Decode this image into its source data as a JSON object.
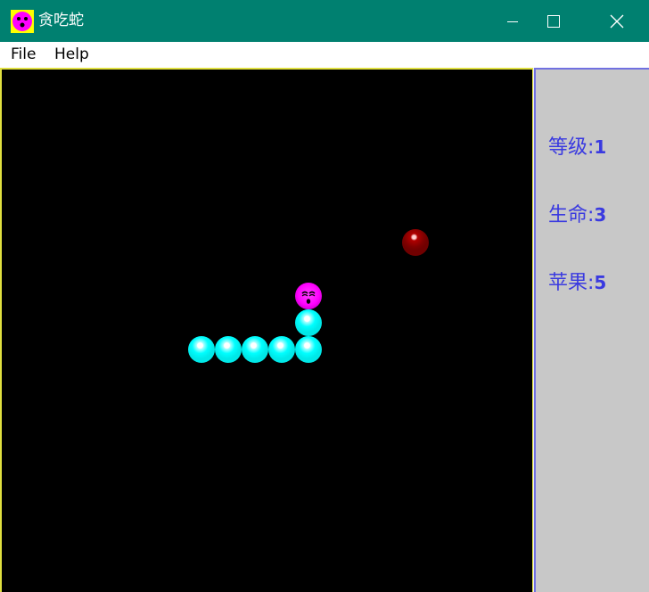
{
  "window": {
    "title": "贪吃蛇",
    "controls": [
      "minimize",
      "maximize",
      "close"
    ]
  },
  "menu": {
    "items": [
      {
        "label": "File"
      },
      {
        "label": "Help"
      }
    ]
  },
  "stats": {
    "level": {
      "label": "等级:",
      "value": "1"
    },
    "lives": {
      "label": "生命:",
      "value": "3"
    },
    "apples": {
      "label": "苹果:",
      "value": "5"
    }
  },
  "colors": {
    "titlebar": "#008070",
    "game_bg": "#000000",
    "panel_bg": "#c8c8c8",
    "stat_text": "#3a3ae0",
    "snake_body": "#00ffff",
    "snake_head": "#ff00ff",
    "apple": "#800000"
  },
  "icons": {
    "app": "snake-face-icon",
    "minimize": "minimize-icon",
    "maximize": "maximize-icon",
    "close": "close-icon"
  }
}
